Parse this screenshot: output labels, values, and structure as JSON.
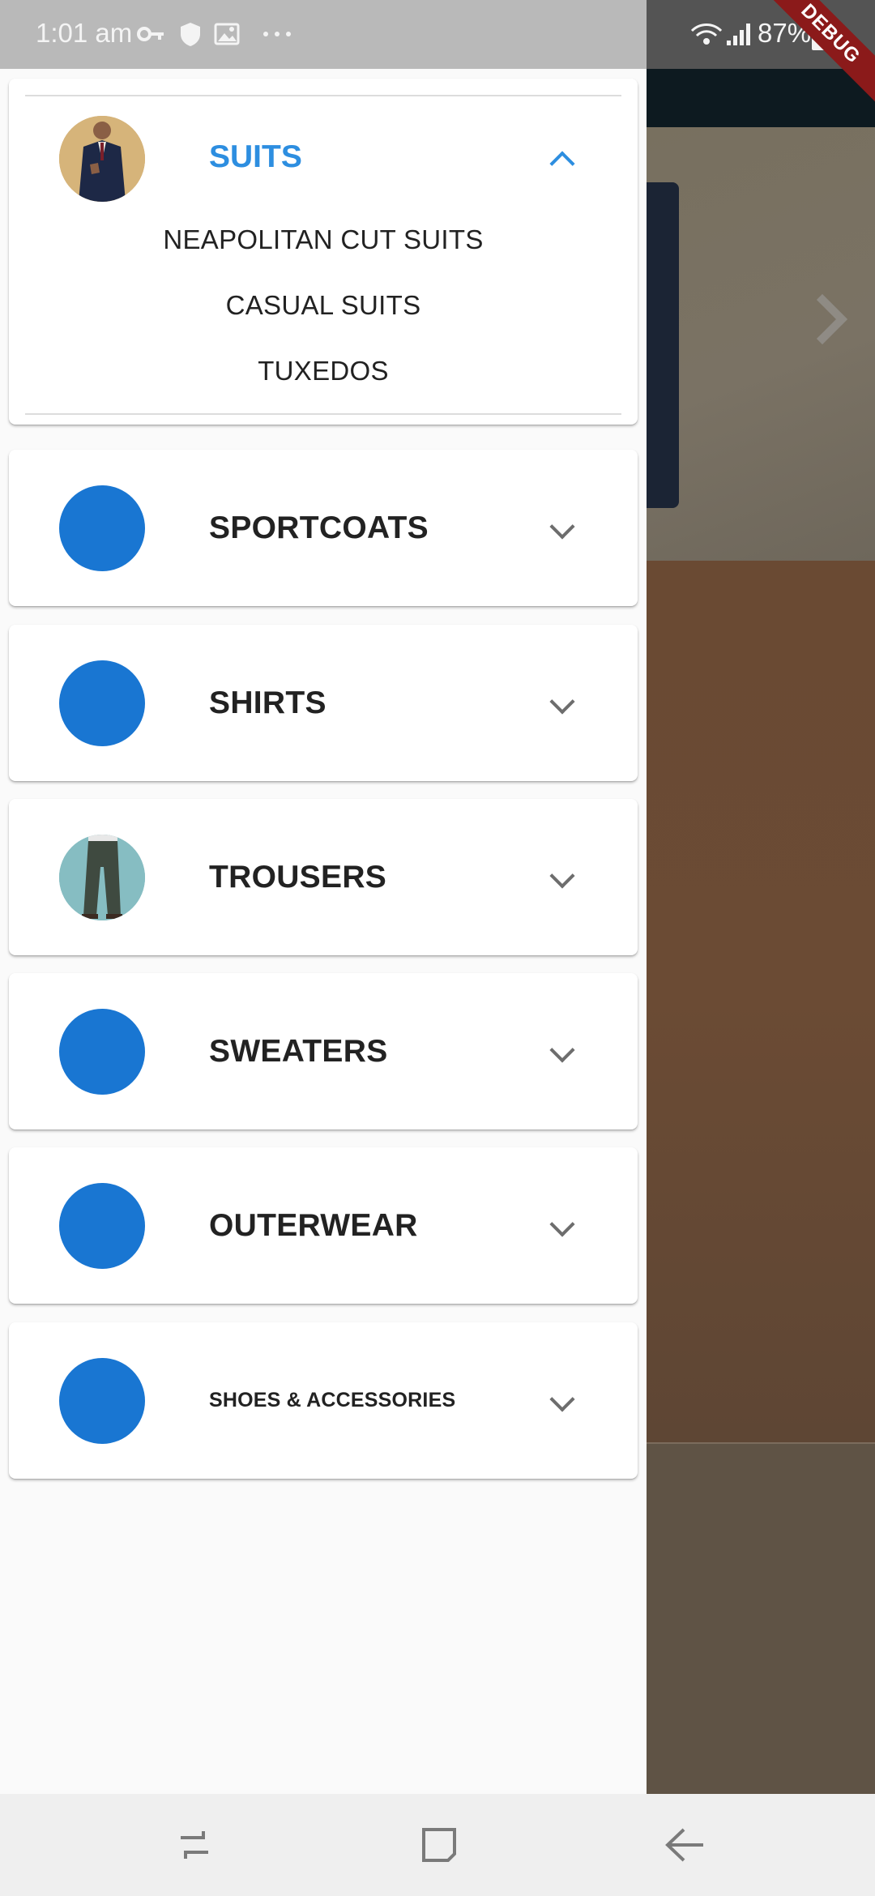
{
  "status_bar": {
    "time": "1:01 am",
    "battery": "87%",
    "debug_banner": "DEBUG",
    "icons": [
      "key-icon",
      "shield-icon",
      "image-icon",
      "more-dots-icon",
      "wifi-icon",
      "signal-icon",
      "battery-charging-icon"
    ]
  },
  "drawer": {
    "categories": [
      {
        "label": "SUITS",
        "expanded": true,
        "accent_color": "#2d8ee0",
        "subitems": [
          "NEAPOLITAN CUT SUITS",
          "CASUAL SUITS",
          "TUXEDOS"
        ]
      },
      {
        "label": "SPORTCOATS",
        "expanded": false,
        "avatar_color": "#1976d2"
      },
      {
        "label": "SHIRTS",
        "expanded": false,
        "avatar_color": "#1976d2"
      },
      {
        "label": "TROUSERS",
        "expanded": false
      },
      {
        "label": "SWEATERS",
        "expanded": false,
        "avatar_color": "#1976d2"
      },
      {
        "label": "OUTERWEAR",
        "expanded": false,
        "avatar_color": "#1976d2"
      },
      {
        "label": "SHOES & ACCESSORIES",
        "expanded": false,
        "avatar_color": "#1976d2"
      }
    ]
  },
  "nav_bar": {
    "buttons": [
      "recent-apps-icon",
      "home-icon",
      "back-icon"
    ]
  }
}
